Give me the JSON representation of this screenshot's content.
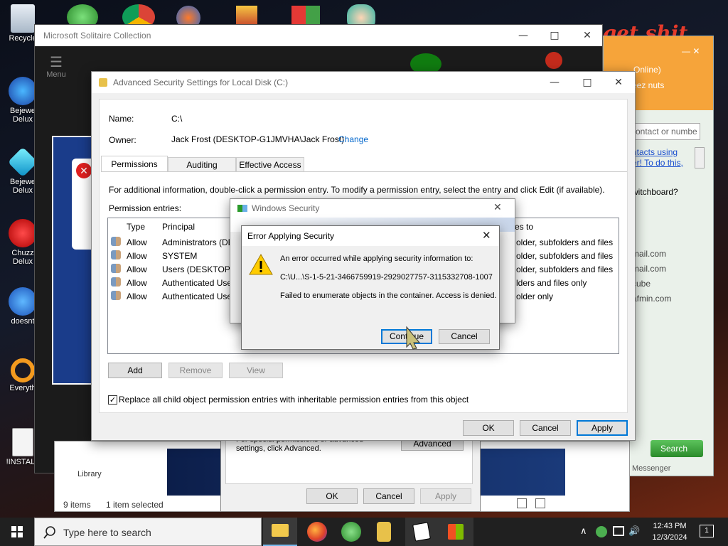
{
  "desktop": {
    "icons": [
      {
        "label": "Recycle"
      },
      {
        "label": "Bejewe\nDelux"
      },
      {
        "label": "Bejewe\nDelux"
      },
      {
        "label": "Chuzz\nDelux"
      },
      {
        "label": "doesnt"
      },
      {
        "label": "Everyth"
      },
      {
        "label": "!INSTALL"
      }
    ],
    "bg_text": "e get shit"
  },
  "solitaire": {
    "title": "Microsoft Solitaire Collection",
    "menu_label": "Menu"
  },
  "messenger": {
    "status_text": "Online)",
    "contact_text": "eez nuts",
    "search_placeholder": "ontact or numbe",
    "link_line1": "ntacts using",
    "link_line2": "er! To do this,",
    "switchboard": "witchboard?",
    "emails": [
      "mail.com",
      "mail.com",
      "cube",
      "afmin.com"
    ],
    "search_button": "Search",
    "footer": "Messenger"
  },
  "explorer_bg": {
    "status_items": "9 items",
    "status_selected": "1 item selected",
    "library_label": "Library"
  },
  "props_dialog": {
    "special_text": "For special permissions or advanced settings, click Advanced.",
    "advanced_button": "Advanced",
    "ok": "OK",
    "cancel": "Cancel",
    "apply": "Apply"
  },
  "advsec": {
    "title": "Advanced Security Settings for Local Disk (C:)",
    "name_label": "Name:",
    "name_value": "C:\\",
    "owner_label": "Owner:",
    "owner_value": "Jack Frost (DESKTOP-G1JMVHA\\Jack Frost)",
    "change_link": "Change",
    "tabs": [
      "Permissions",
      "Auditing",
      "Effective Access"
    ],
    "info_text": "For additional information, double-click a permission entry. To modify a permission entry, select the entry and click Edit (if available).",
    "entries_label": "Permission entries:",
    "columns": [
      "Type",
      "Principal",
      "es to"
    ],
    "rows": [
      {
        "type": "Allow",
        "principal": "Administrators (DE",
        "applies": "older, subfolders and files"
      },
      {
        "type": "Allow",
        "principal": "SYSTEM",
        "applies": "older, subfolders and files"
      },
      {
        "type": "Allow",
        "principal": "Users (DESKTOP-G",
        "applies": "older, subfolders and files"
      },
      {
        "type": "Allow",
        "principal": "Authenticated Use",
        "applies": "lders and files only"
      },
      {
        "type": "Allow",
        "principal": "Authenticated Use",
        "applies": "older only"
      }
    ],
    "add": "Add",
    "remove": "Remove",
    "view": "View",
    "replace_checkbox": "Replace all child object permission entries with inheritable permission entries from this object",
    "ok": "OK",
    "cancel": "Cancel",
    "apply": "Apply"
  },
  "winsec": {
    "title": "Windows Security"
  },
  "error": {
    "title": "Error Applying Security",
    "line1": "An error occurred while applying security information to:",
    "line2": "C:\\U...\\S-1-5-21-3466759919-2929027757-3115332708-1007",
    "line3": "Failed to enumerate objects in the container. Access is denied.",
    "continue": "Continue",
    "cancel": "Cancel"
  },
  "taskbar": {
    "search_placeholder": "Type here to search",
    "time": "12:43 PM",
    "date": "12/3/2024",
    "notification_count": "1"
  },
  "colors": {
    "accent": "#0078d7",
    "taskbar": "#202020",
    "warning": "#ffcc00",
    "messenger_orange": "#f6a43a"
  }
}
